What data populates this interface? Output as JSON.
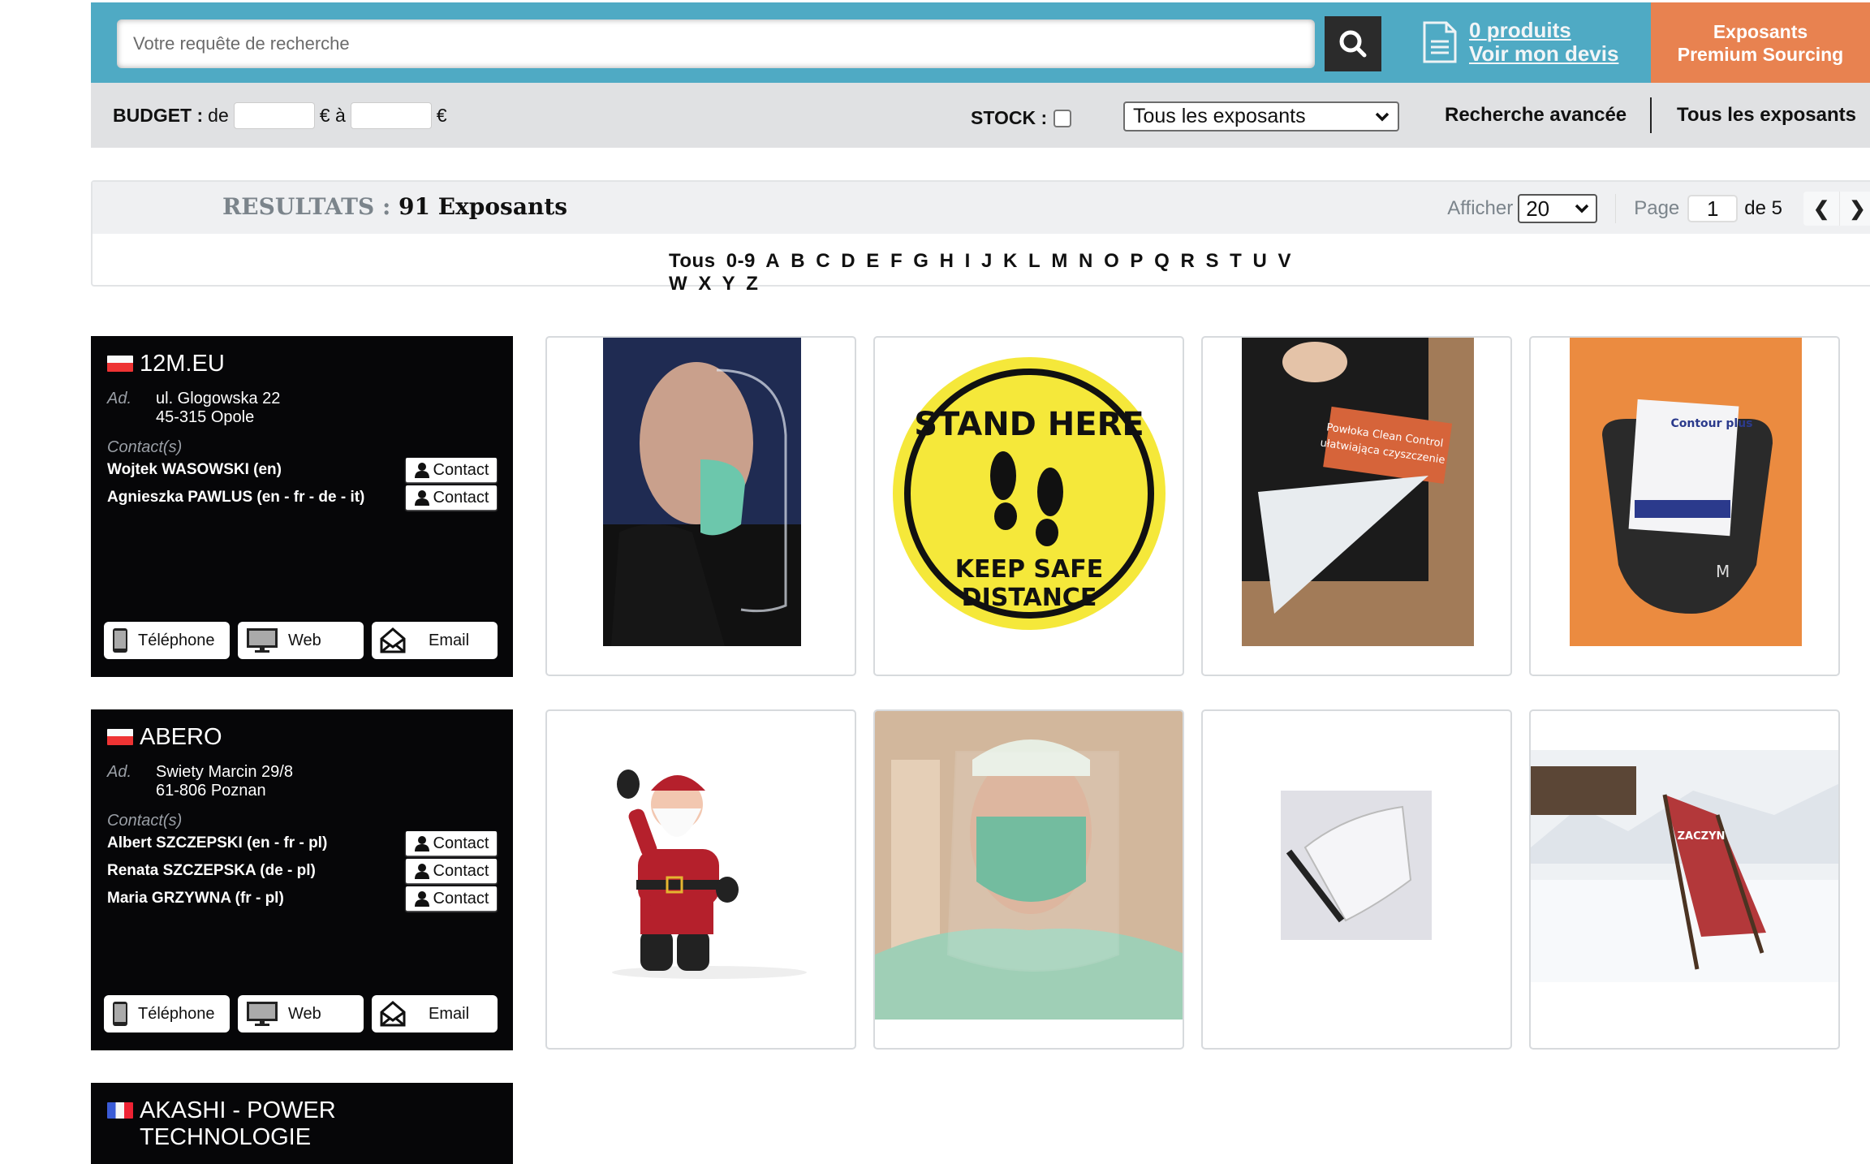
{
  "header": {
    "search_placeholder": "Votre requête de recherche",
    "search_value": "",
    "cart_count": "0",
    "cart_label": "produits",
    "quote_link": "Voir mon devis",
    "premium_line1": "Exposants",
    "premium_line2": "Premium Sourcing"
  },
  "filters": {
    "budget_label": "BUDGET :",
    "budget_from": "de",
    "budget_to": "€ à",
    "budget_currency": "€",
    "budget_min_value": "",
    "budget_max_value": "",
    "stock_label": "STOCK :",
    "stock_checked": false,
    "exhibitor_select_value": "Tous les exposants",
    "advanced_search": "Recherche avancée",
    "all_exhibitors": "Tous les exposants"
  },
  "results": {
    "label": "RESULTATS :",
    "count_text": "91 Exposants",
    "show_label": "Afficher",
    "per_page": "20",
    "page_label": "Page",
    "current_page": "1",
    "total_pages_text": "de 5",
    "prev": "❮",
    "next": "❯",
    "alphabet": [
      "Tous",
      "0-9",
      "A",
      "B",
      "C",
      "D",
      "E",
      "F",
      "G",
      "H",
      "I",
      "J",
      "K",
      "L",
      "M",
      "N",
      "O",
      "P",
      "Q",
      "R",
      "S",
      "T",
      "U",
      "V",
      "W",
      "X",
      "Y",
      "Z"
    ]
  },
  "labels": {
    "address": "Ad.",
    "contacts": "Contact(s)",
    "contact_button": "Contact",
    "phone": "Téléphone",
    "web": "Web",
    "email": "Email"
  },
  "exhibitors": [
    {
      "name": "12M.EU",
      "country": "pl",
      "address_line1": "ul. Glogowska 22",
      "address_line2": "45-315 Opole",
      "contacts": [
        "Wojtek WASOWSKI (en)",
        "Agnieszka PAWLUS (en - fr - de - it)"
      ],
      "products": [
        {
          "image": "man-with-face-shield-and-mask"
        },
        {
          "image": "stand-here-keep-safe-distance-sticker",
          "text1": "STAND HERE",
          "text2": "KEEP SAFE",
          "text3": "DISTANCE"
        },
        {
          "image": "clean-control-coating-film",
          "text1": "Powłoka Clean Control",
          "text2": "ułatwiająca czyszczenie"
        },
        {
          "image": "contour-plus-glucose-meter",
          "text1": "Contour plus"
        }
      ]
    },
    {
      "name": "ABERO",
      "country": "pl",
      "address_line1": "Swiety Marcin 29/8",
      "address_line2": "61-806 Poznan",
      "contacts": [
        "Albert SZCZEPSKI (en - fr - pl)",
        "Renata SZCZEPSKA (de - pl)",
        "Maria GRZYWNA (fr - pl)"
      ],
      "products": [
        {
          "image": "inflatable-santa-claus"
        },
        {
          "image": "woman-with-face-shield-and-mask"
        },
        {
          "image": "clear-face-shield-visor"
        },
        {
          "image": "branded-deck-chair-in-snow",
          "text1": "ZACZYN"
        }
      ]
    },
    {
      "name": "AKASHI - POWER TECHNOLOGIE",
      "country": "fr"
    }
  ],
  "colors": {
    "header_teal": "#4faac4",
    "premium_orange": "#e88250",
    "filter_grey": "#e0e1e3",
    "card_black": "#060608"
  }
}
